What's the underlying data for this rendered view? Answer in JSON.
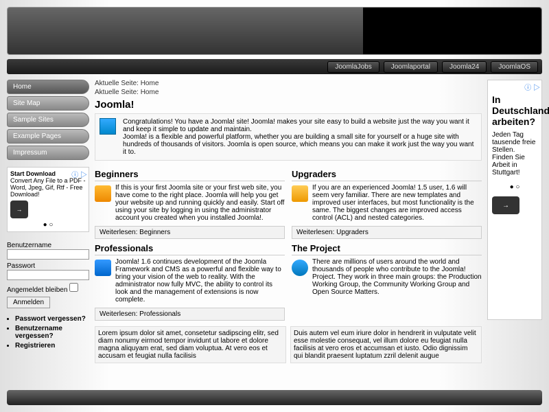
{
  "topnav": [
    "JoomlaJobs",
    "Joomlaportal",
    "Joomla24",
    "JoomlaOS"
  ],
  "menu": [
    "Home",
    "Site Map",
    "Sample Sites",
    "Example Pages",
    "Impressum"
  ],
  "breadcrumb": "Aktuelle Seite: Home",
  "title": "Joomla!",
  "intro": {
    "p1": "Congratulations! You have a Joomla! site! Joomla! makes your site easy to build a website just the way you want it and keep it simple to update and maintain.",
    "p2": "Joomla! is a flexible and powerful platform, whether you are building a small site for yourself or a huge site with hundreds of thousands of visitors. Joomla is open source, which means you can make it work just the way you want it to."
  },
  "sections": {
    "beginners": {
      "h": "Beginners",
      "t": "If this is your first Joomla site or your first web site, you have come to the right place. Joomla will help you get your website up and running quickly and easily.\nStart off using your site by logging in using the administrator account you created when you installed Joomla!.",
      "r": "Weiterlesen: Beginners"
    },
    "upgraders": {
      "h": "Upgraders",
      "t": "If you are an experienced Joomla! 1.5 user, 1.6 will seem very familiar. There are new templates and improved user interfaces, but most functionality is the same. The biggest changes are improved access control (ACL) and nested categories.",
      "r": "Weiterlesen: Upgraders"
    },
    "professionals": {
      "h": "Professionals",
      "t": "Joomla! 1.6 continues development of the Joomla Framework and CMS as a powerful and flexible way to bring your vision of the web to reality. With the administrator now fully MVC, the ability to control its look and the management of extensions is now complete.",
      "r": "Weiterlesen: Professionals"
    },
    "project": {
      "h": "The Project",
      "t": "There are millions of users around the world and thousands of people who contribute to the Joomla! Project. They work in three main groups: the Production Working Group,  the Community Working Group and Open Source Matters."
    }
  },
  "lorem": {
    "l": "Lorem ipsum dolor sit amet, consetetur sadipscing elitr, sed diam nonumy eirmod tempor invidunt ut labore et dolore magna aliquyam erat, sed diam voluptua. At vero eos et accusam et feugiat nulla facilisis",
    "r": "Duis autem vel eum iriure dolor in hendrerit in vulputate velit esse molestie consequat, vel illum dolore eu feugiat nulla facilisis at vero eros et accumsan et iusto. Odio dignissim qui blandit praesent luptatum zzril delenit augue"
  },
  "ad_small": {
    "title": "Start Download",
    "body": "Convert Any File to a PDF - Word, Jpeg, Gif, Rtf - Free Download!"
  },
  "ad_right": {
    "title": "In Deutschland arbeiten?",
    "body": "Jeden Tag tausende freie Stellen. Finden Sie Arbeit in Stuttgart!"
  },
  "login": {
    "user": "Benutzername",
    "pass": "Passwort",
    "remember": "Angemeldet bleiben",
    "submit": "Anmelden"
  },
  "links": [
    "Passwort vergessen?",
    "Benutzername vergessen?",
    "Registrieren"
  ]
}
